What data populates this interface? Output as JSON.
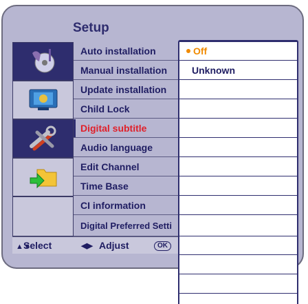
{
  "title": "Setup",
  "icons": [
    "settings-disc-icon",
    "tv-display-icon",
    "tools-icon",
    "folder-icon"
  ],
  "menu": [
    {
      "label": "Auto installation"
    },
    {
      "label": "Manual installation"
    },
    {
      "label": "Update installation"
    },
    {
      "label": "Child Lock"
    },
    {
      "label": "Digital subtitle",
      "highlighted": true
    },
    {
      "label": "Audio language"
    },
    {
      "label": "Edit Channel"
    },
    {
      "label": "Time Base"
    },
    {
      "label": "CI information"
    },
    {
      "label": "Digital Preferred Setti"
    }
  ],
  "submenu": [
    {
      "label": "Off",
      "selected": true
    },
    {
      "label": "Unknown"
    }
  ],
  "footer": {
    "select": "Select",
    "adjust": "Adjust",
    "ok": "OK"
  },
  "colors": {
    "highlight": "#e0202a",
    "selected": "#f08a00",
    "panel": "#b7b6d1",
    "dark": "#2e2d6e"
  }
}
